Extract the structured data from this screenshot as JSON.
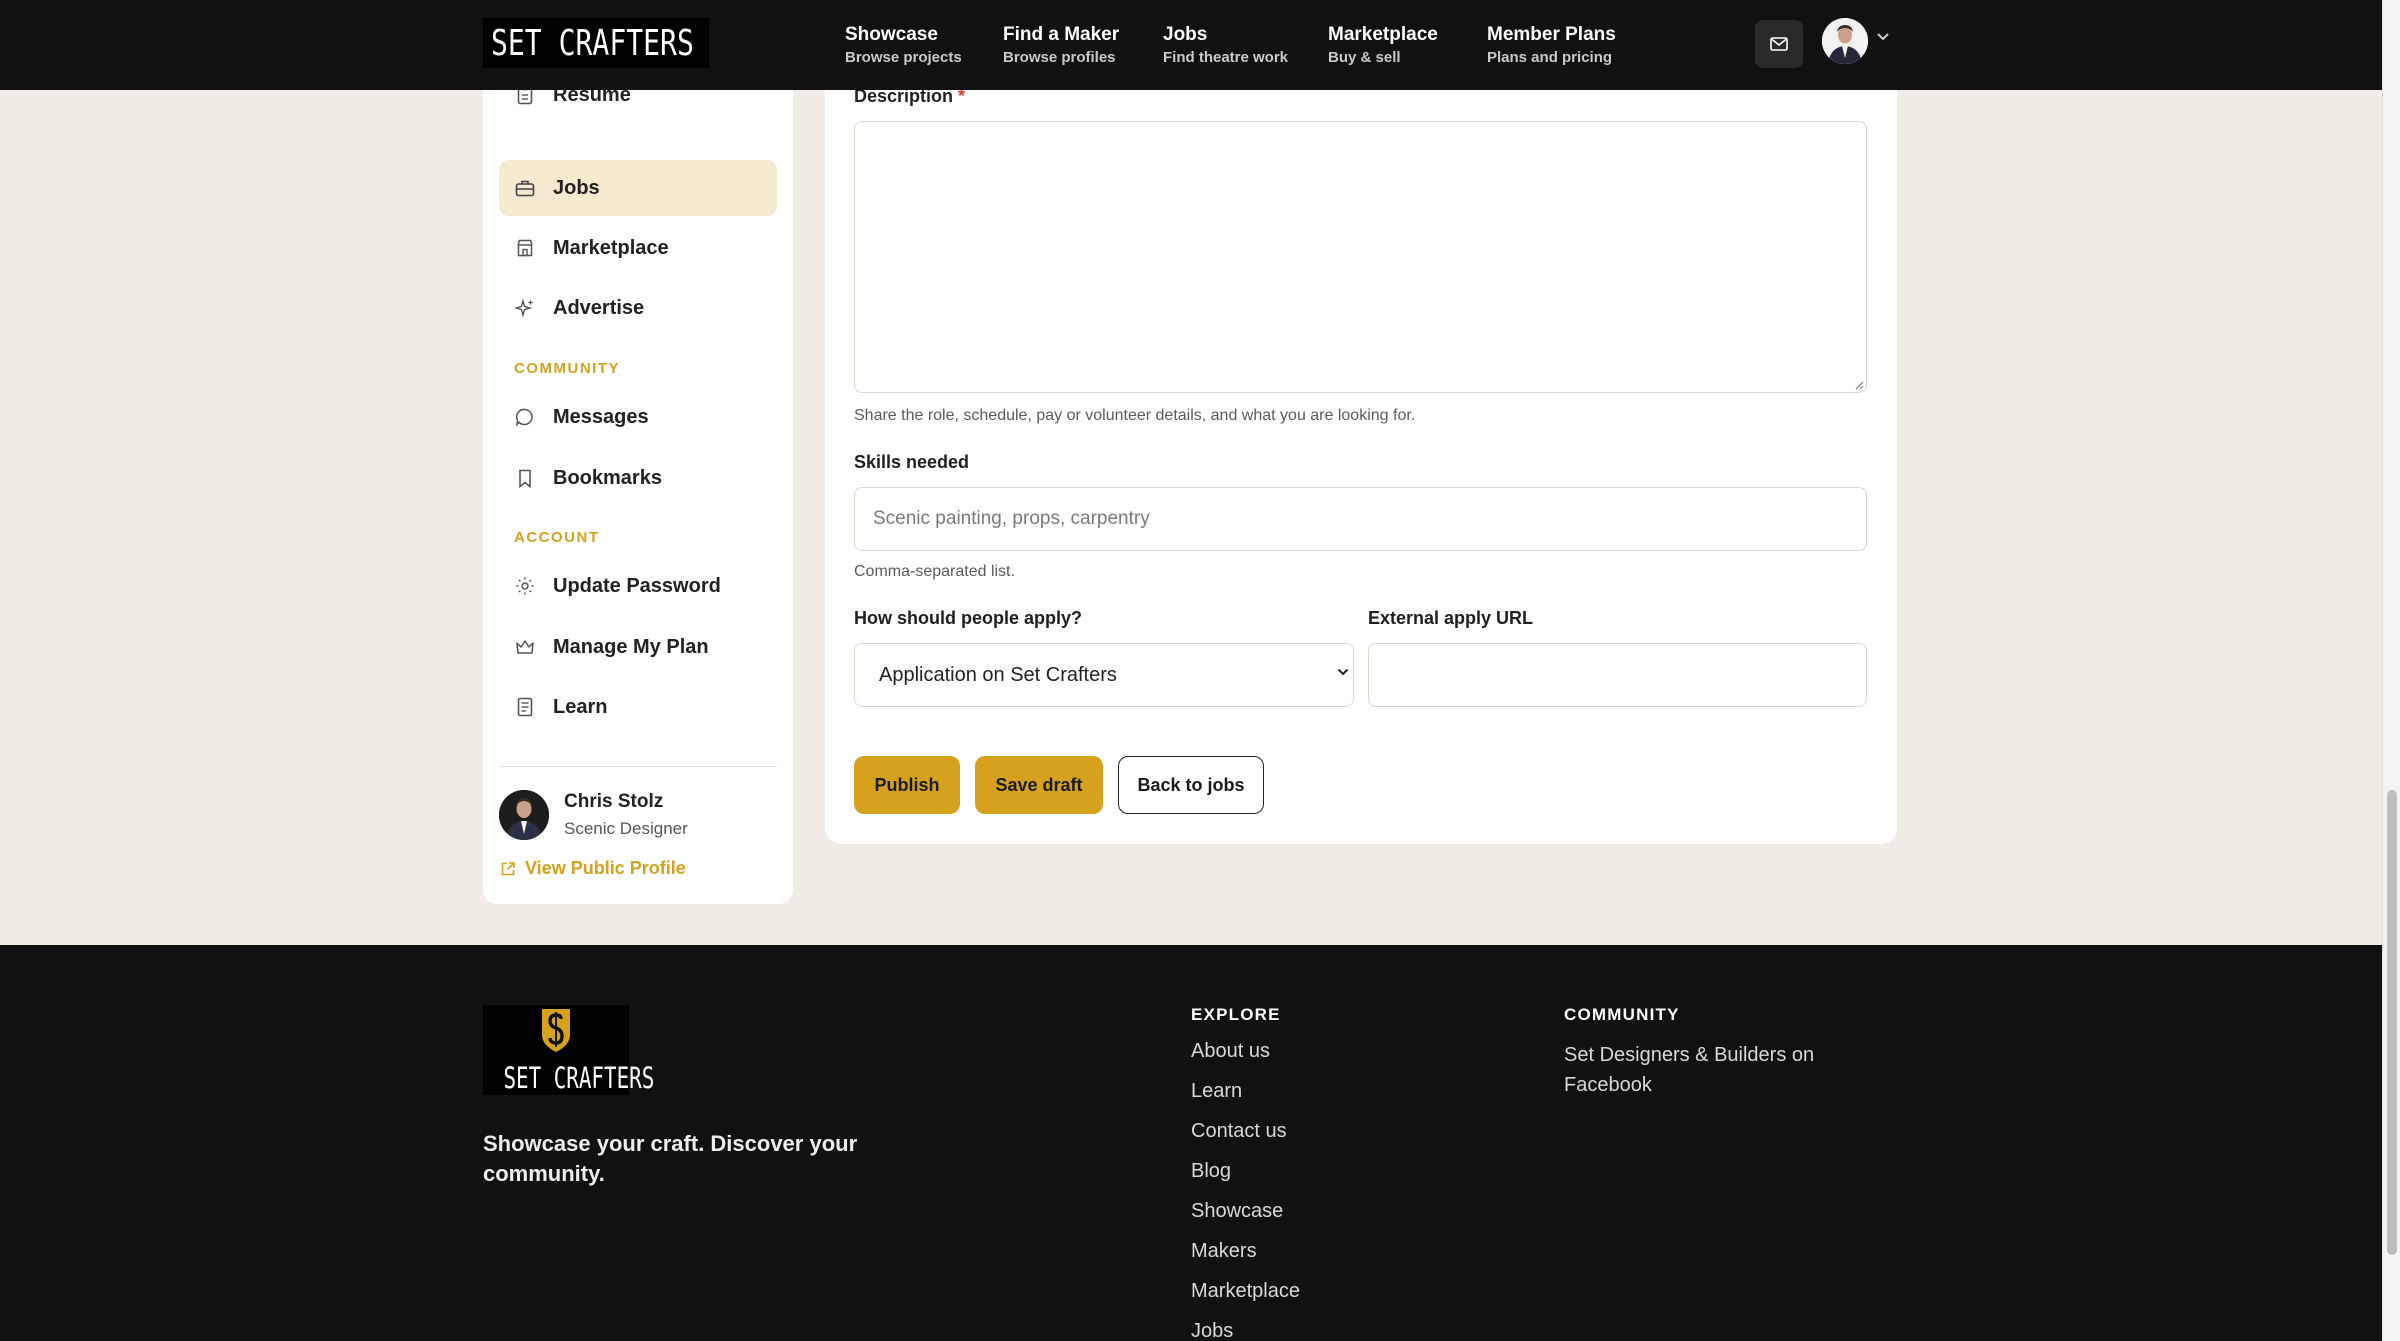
{
  "brand": {
    "name": "SET CRAFTERS",
    "accent": "#d6a21e"
  },
  "nav": [
    {
      "title": "Showcase",
      "subtitle": "Browse projects"
    },
    {
      "title": "Find a Maker",
      "subtitle": "Browse profiles"
    },
    {
      "title": "Jobs",
      "subtitle": "Find theatre work"
    },
    {
      "title": "Marketplace",
      "subtitle": "Buy & sell"
    },
    {
      "title": "Member Plans",
      "subtitle": "Plans and pricing"
    }
  ],
  "header_icons": {
    "mail": "mail-icon",
    "avatar": "user-avatar",
    "menu": "chevron-down-icon"
  },
  "sidebar": {
    "items": [
      {
        "label": "Resume",
        "icon": "clipboard-icon",
        "active": false
      },
      {
        "label": "Jobs",
        "icon": "briefcase-icon",
        "active": true
      },
      {
        "label": "Marketplace",
        "icon": "store-icon",
        "active": false
      },
      {
        "label": "Advertise",
        "icon": "sparkle-icon",
        "active": false
      }
    ],
    "community_heading": "COMMUNITY",
    "community_items": [
      {
        "label": "Messages",
        "icon": "chat-bubble-icon"
      },
      {
        "label": "Bookmarks",
        "icon": "bookmark-icon"
      }
    ],
    "account_heading": "ACCOUNT",
    "account_items": [
      {
        "label": "Update Password",
        "icon": "sun-gear-icon"
      },
      {
        "label": "Manage My Plan",
        "icon": "crown-icon"
      },
      {
        "label": "Learn",
        "icon": "book-icon"
      }
    ],
    "user": {
      "name": "Chris Stolz",
      "role": "Scenic Designer"
    },
    "view_profile": "View Public Profile"
  },
  "form": {
    "description_label": "Description",
    "required_mark": "*",
    "description_value": "",
    "description_help": "Share the role, schedule, pay or volunteer details, and what you are looking for.",
    "skills_label": "Skills needed",
    "skills_placeholder": "Scenic painting, props, carpentry",
    "skills_help": "Comma-separated list.",
    "apply_label": "How should people apply?",
    "apply_value": "Application on Set Crafters",
    "url_label": "External apply URL",
    "url_value": "",
    "publish": "Publish",
    "save_draft": "Save draft",
    "back": "Back to jobs"
  },
  "footer": {
    "brand": "SET CRAFTERS",
    "tagline": "Showcase your craft. Discover your community.",
    "explore_heading": "EXPLORE",
    "explore_links": [
      "About us",
      "Learn",
      "Contact us",
      "Blog",
      "Showcase",
      "Makers",
      "Marketplace",
      "Jobs"
    ],
    "community_heading": "COMMUNITY",
    "community_links": [
      "Set Designers & Builders on Facebook"
    ]
  }
}
